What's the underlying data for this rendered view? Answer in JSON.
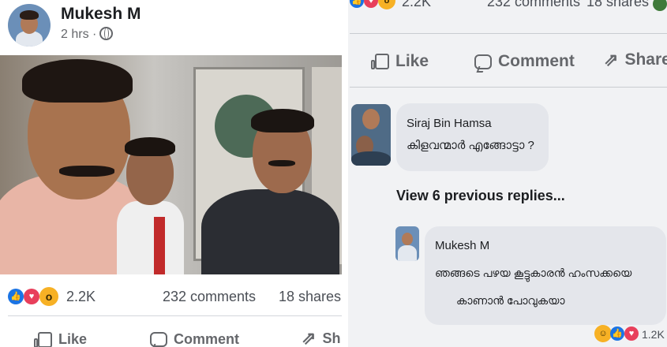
{
  "left_post": {
    "author": "Mukesh M",
    "time": "2 hrs ·",
    "reaction_count": "2.2K",
    "comments": "232 comments",
    "shares": "18 shares",
    "actions": {
      "like": "Like",
      "comment": "Comment",
      "share": "Sh"
    }
  },
  "right_post": {
    "reaction_count": "2.2K",
    "comments": "232 comments",
    "shares": "18 shares",
    "actions": {
      "like": "Like",
      "comment": "Comment",
      "share": "Share"
    },
    "comments_list": [
      {
        "author": "Siraj Bin Hamsa",
        "text": "കിളവന്മാർ എങ്ങോട്ടാ ?"
      },
      {
        "author": "Mukesh M",
        "text_line1": "ഞങ്ങടെ പഴയ കൂട്ടുകാരൻ ഹംസക്കയെ",
        "text_line2": "കാണാൻ പോവുകയാ"
      }
    ],
    "view_replies": "View 6 previous replies...",
    "reply_reaction_count": "1.2K"
  },
  "colors": {
    "like_blue": "#1b74e4",
    "love_red": "#e83f5b",
    "wow_yellow": "#f7b125",
    "text": "#1c1e21",
    "muted": "#65676b"
  }
}
